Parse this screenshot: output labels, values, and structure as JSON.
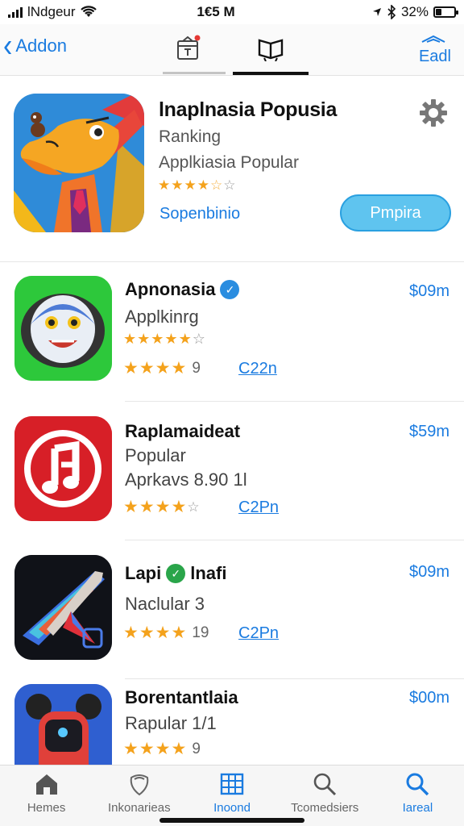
{
  "status_bar": {
    "carrier": "lNdgeur",
    "time": "1€5 M",
    "battery": "32%",
    "battery_level": 0.32
  },
  "nav": {
    "back_label": "Addon",
    "right_label": "Eadl",
    "icons": [
      "gift-icon",
      "book-icon"
    ]
  },
  "featured": {
    "title": "lnaplnasia Popusia",
    "subtitle1": "Ranking",
    "subtitle2": "Applkiasia Popular",
    "rating": 4.5,
    "link": "Sopenbinio",
    "button_label": "Pmpira"
  },
  "apps": [
    {
      "name": "Apnonasia",
      "verified": true,
      "verified_color": "#2a8de0",
      "line2": "Applkinrg",
      "rating": 4.5,
      "rating_text": "9",
      "size": "C22n",
      "price": "$09m",
      "icon": "face-icon"
    },
    {
      "name": "Raplamaideat",
      "verified": false,
      "line2": "Popular",
      "line3": "Aprkavs 8.90 1l",
      "rating": 4.5,
      "rating_text": "",
      "size": "C2Pn",
      "price": "$59m",
      "icon": "music-note-icon"
    },
    {
      "name_a": "Lapi",
      "name_b": "lnafi",
      "verified": true,
      "verified_color": "#2aa54a",
      "line2": "Naclular 3",
      "rating": 4,
      "rating_text": "19",
      "size": "C2Pn",
      "price": "$09m",
      "icon": "rocket-icon"
    },
    {
      "name": "Borentantlaia",
      "verified": false,
      "line2": "Rapular 1/1",
      "rating": 4.5,
      "rating_text": "9",
      "price": "$00m",
      "icon": "robot-icon"
    }
  ],
  "tabs": [
    {
      "label": "Hemes",
      "icon": "home-icon",
      "active": false
    },
    {
      "label": "Inkonarieas",
      "icon": "shield-icon",
      "active": false
    },
    {
      "label": "Inoond",
      "icon": "grid-icon",
      "active": true
    },
    {
      "label": "Tcomedsiers",
      "icon": "search-icon",
      "active": false
    },
    {
      "label": "Iareal",
      "icon": "search-icon",
      "active": true
    }
  ],
  "colors": {
    "accent": "#1a7be0",
    "star": "#f4a21c",
    "button": "#5fc4ef"
  }
}
